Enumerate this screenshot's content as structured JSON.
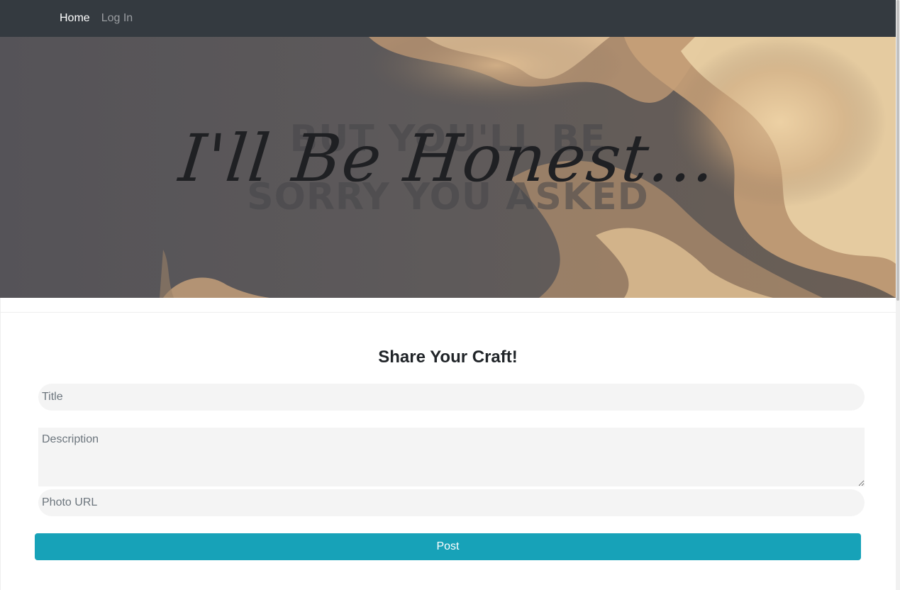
{
  "nav": {
    "home_label": "Home",
    "login_label": "Log In"
  },
  "hero": {
    "title": "I'll Be Honest...",
    "ghost_line_1": "BUT YOU'LL BE",
    "ghost_line_2": "SORRY YOU ASKED"
  },
  "form": {
    "heading": "Share Your Craft!",
    "title_placeholder": "Title",
    "description_placeholder": "Description",
    "photo_placeholder": "Photo URL",
    "post_label": "Post"
  },
  "colors": {
    "navbar": "#343a40",
    "accent": "#17a2b8",
    "input_bg": "#f4f4f4"
  }
}
